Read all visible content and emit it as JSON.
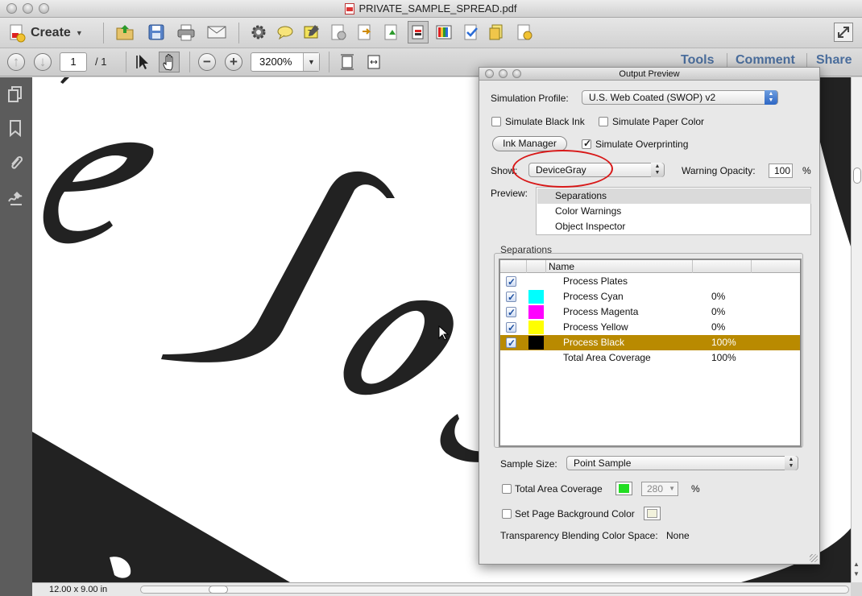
{
  "window": {
    "title": "PRIVATE_SAMPLE_SPREAD.pdf"
  },
  "toolbar": {
    "create_label": "Create",
    "icons": [
      "open-folder-icon",
      "save-icon",
      "print-icon",
      "email-icon",
      "gear-icon",
      "comment-icon",
      "highlight-icon",
      "stamp-icon",
      "export-icon",
      "convert-icon",
      "output-preview-icon",
      "color-bars-icon",
      "preflight-icon",
      "fix-icon",
      "ink-icon",
      "fullscreen-icon"
    ]
  },
  "nav": {
    "page_number": "1",
    "page_total": "/  1",
    "zoom": "3200%",
    "tools_link": "Tools",
    "comment_link": "Comment",
    "share_link": "Share"
  },
  "status": {
    "page_size": "12.00 x 9.00 in"
  },
  "panel": {
    "title": "Output Preview",
    "simulation_profile_label": "Simulation Profile:",
    "simulation_profile_value": "U.S. Web Coated (SWOP) v2",
    "simulate_black_ink": {
      "label": "Simulate Black Ink",
      "checked": false
    },
    "simulate_paper_color": {
      "label": "Simulate Paper Color",
      "checked": false
    },
    "ink_manager_label": "Ink Manager",
    "simulate_overprinting": {
      "label": "Simulate Overprinting",
      "checked": true
    },
    "show_label": "Show:",
    "show_value": "DeviceGray",
    "warning_opacity_label": "Warning Opacity:",
    "warning_opacity_value": "100",
    "percent": "%",
    "preview_label": "Preview:",
    "preview_options": [
      "Separations",
      "Color Warnings",
      "Object Inspector"
    ],
    "preview_selected": "Separations",
    "separations_label": "Separations",
    "table_header_name": "Name",
    "separations": [
      {
        "name": "Process Plates",
        "percent": "",
        "color": "",
        "selected": false
      },
      {
        "name": "Process Cyan",
        "percent": "0%",
        "color": "#00ffff",
        "selected": false
      },
      {
        "name": "Process Magenta",
        "percent": "0%",
        "color": "#ff00ff",
        "selected": false
      },
      {
        "name": "Process Yellow",
        "percent": "0%",
        "color": "#ffff00",
        "selected": false
      },
      {
        "name": "Process Black",
        "percent": "100%",
        "color": "#000000",
        "selected": true
      },
      {
        "name": "Total Area Coverage",
        "percent": "100%",
        "color": "",
        "selected": false
      }
    ],
    "sample_size_label": "Sample Size:",
    "sample_size_value": "Point Sample",
    "total_area_coverage": {
      "label": "Total Area Coverage",
      "checked": false,
      "swatch_color": "#22dd22",
      "value": "280",
      "percent": "%"
    },
    "set_page_bg": {
      "label": "Set Page Background Color",
      "checked": false,
      "swatch_color": "#f2f2dc"
    },
    "transparency_label": "Transparency Blending Color Space:",
    "transparency_value": "None"
  }
}
